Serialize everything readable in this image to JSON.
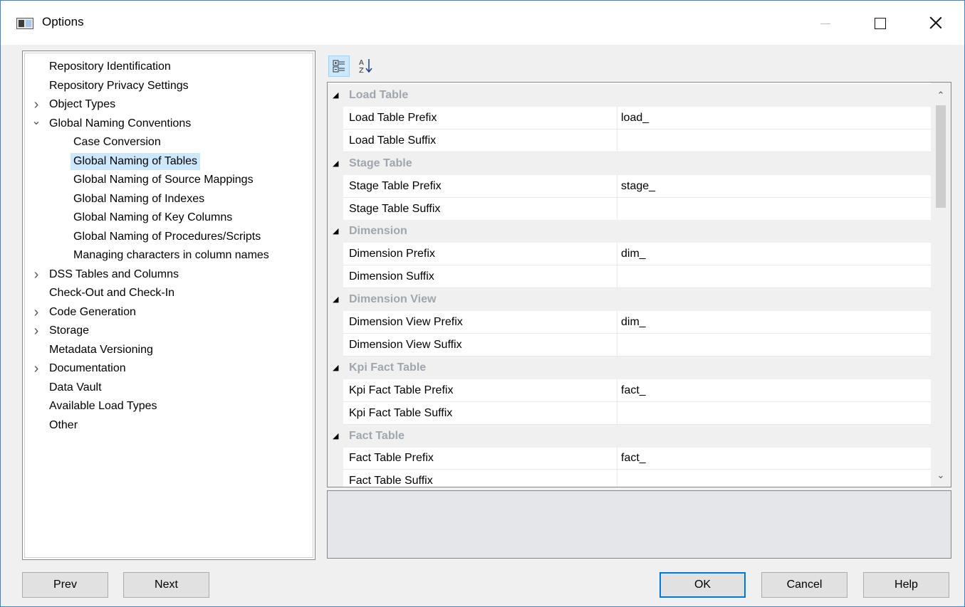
{
  "window": {
    "title": "Options"
  },
  "tree": {
    "items": [
      {
        "label": "Repository Identification",
        "level": 0,
        "expander": "none",
        "selected": false
      },
      {
        "label": "Repository Privacy Settings",
        "level": 0,
        "expander": "none",
        "selected": false
      },
      {
        "label": "Object Types",
        "level": 0,
        "expander": "collapsed",
        "selected": false
      },
      {
        "label": "Global Naming Conventions",
        "level": 0,
        "expander": "expanded",
        "selected": false
      },
      {
        "label": "Case Conversion",
        "level": 1,
        "expander": "none",
        "selected": false
      },
      {
        "label": "Global Naming of Tables",
        "level": 1,
        "expander": "none",
        "selected": true
      },
      {
        "label": "Global Naming of Source Mappings",
        "level": 1,
        "expander": "none",
        "selected": false
      },
      {
        "label": "Global Naming of Indexes",
        "level": 1,
        "expander": "none",
        "selected": false
      },
      {
        "label": "Global Naming of Key Columns",
        "level": 1,
        "expander": "none",
        "selected": false
      },
      {
        "label": "Global Naming of Procedures/Scripts",
        "level": 1,
        "expander": "none",
        "selected": false
      },
      {
        "label": "Managing characters in column names",
        "level": 1,
        "expander": "none",
        "selected": false
      },
      {
        "label": "DSS Tables and Columns",
        "level": 0,
        "expander": "collapsed",
        "selected": false
      },
      {
        "label": "Check-Out and Check-In",
        "level": 0,
        "expander": "none",
        "selected": false
      },
      {
        "label": "Code Generation",
        "level": 0,
        "expander": "collapsed",
        "selected": false
      },
      {
        "label": "Storage",
        "level": 0,
        "expander": "collapsed",
        "selected": false
      },
      {
        "label": "Metadata Versioning",
        "level": 0,
        "expander": "none",
        "selected": false
      },
      {
        "label": "Documentation",
        "level": 0,
        "expander": "collapsed",
        "selected": false
      },
      {
        "label": "Data Vault",
        "level": 0,
        "expander": "none",
        "selected": false
      },
      {
        "label": "Available Load Types",
        "level": 0,
        "expander": "none",
        "selected": false
      },
      {
        "label": "Other",
        "level": 0,
        "expander": "none",
        "selected": false
      }
    ]
  },
  "toolbar": {
    "categorized_icon": "categorized-view-icon",
    "alphabetical_icon": "sort-alphabetical-icon"
  },
  "grid": {
    "rows": [
      {
        "type": "category",
        "label": "Load Table"
      },
      {
        "type": "property",
        "name": "Load Table Prefix",
        "value": "load_"
      },
      {
        "type": "property",
        "name": "Load Table Suffix",
        "value": ""
      },
      {
        "type": "category",
        "label": "Stage Table"
      },
      {
        "type": "property",
        "name": "Stage Table Prefix",
        "value": "stage_"
      },
      {
        "type": "property",
        "name": "Stage Table Suffix",
        "value": ""
      },
      {
        "type": "category",
        "label": "Dimension"
      },
      {
        "type": "property",
        "name": "Dimension Prefix",
        "value": "dim_"
      },
      {
        "type": "property",
        "name": "Dimension Suffix",
        "value": ""
      },
      {
        "type": "category",
        "label": "Dimension View"
      },
      {
        "type": "property",
        "name": "Dimension View Prefix",
        "value": "dim_"
      },
      {
        "type": "property",
        "name": "Dimension View Suffix",
        "value": ""
      },
      {
        "type": "category",
        "label": "Kpi Fact Table"
      },
      {
        "type": "property",
        "name": "Kpi Fact Table Prefix",
        "value": "fact_"
      },
      {
        "type": "property",
        "name": "Kpi Fact Table Suffix",
        "value": ""
      },
      {
        "type": "category",
        "label": "Fact Table"
      },
      {
        "type": "property",
        "name": "Fact Table Prefix",
        "value": "fact_"
      },
      {
        "type": "property",
        "name": "Fact Table Suffix",
        "value": ""
      }
    ]
  },
  "buttons": {
    "prev": "Prev",
    "next": "Next",
    "ok": "OK",
    "cancel": "Cancel",
    "help": "Help"
  },
  "colors": {
    "selection": "#cce8ff",
    "category_text": "#9fa6ae",
    "default_button_border": "#0078d7"
  }
}
